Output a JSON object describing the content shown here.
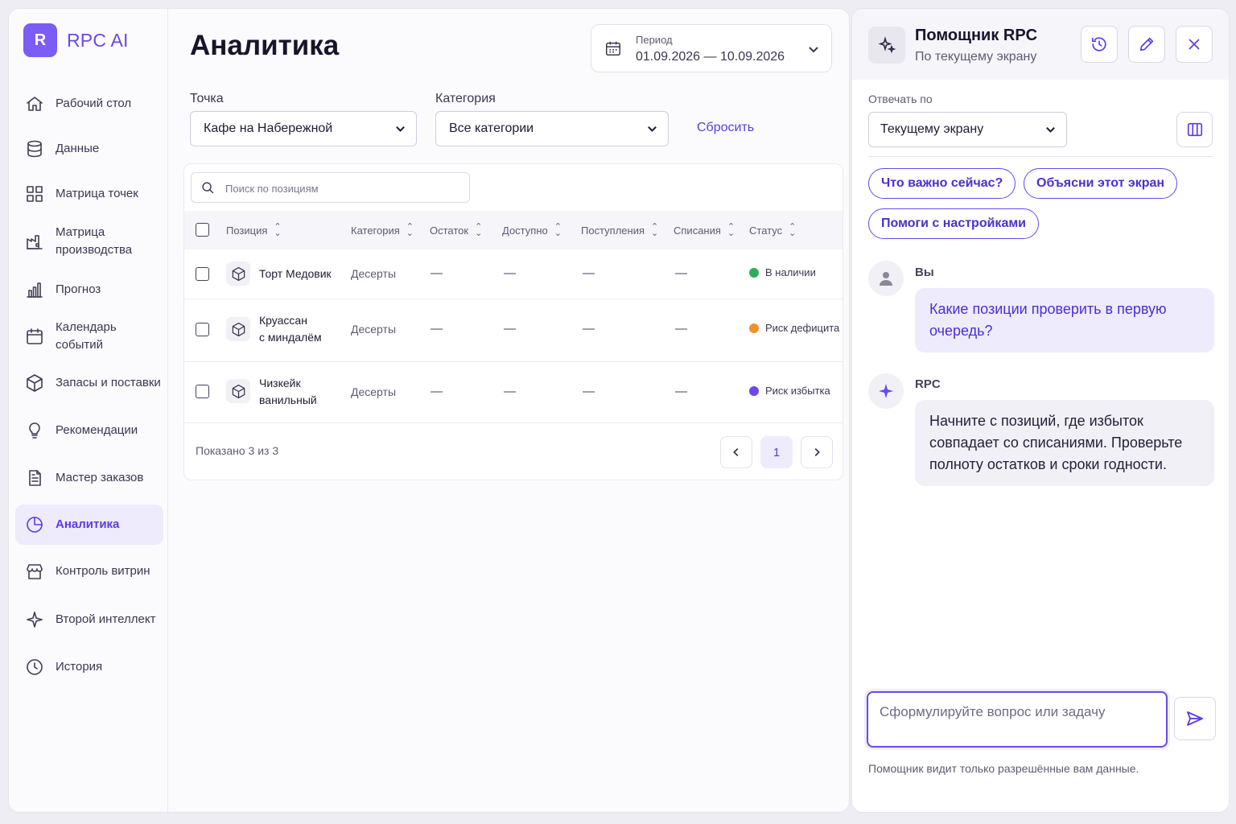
{
  "app": {
    "logo_letter": "R",
    "name": "RPC AI",
    "accent": "#6a48ee"
  },
  "sidebar": {
    "items": [
      {
        "label": "Рабочий стол",
        "icon": "home-icon"
      },
      {
        "label": "Данные",
        "icon": "database-icon"
      },
      {
        "label": "Матрица точек",
        "icon": "grid-icon"
      },
      {
        "label": "Матрица производства",
        "icon": "factory-icon"
      },
      {
        "label": "Прогноз",
        "icon": "bar-chart-icon"
      },
      {
        "label": "Календарь событий",
        "icon": "calendar-icon"
      },
      {
        "label": "Запасы и поставки",
        "icon": "box-icon"
      },
      {
        "label": "Рекомендации",
        "icon": "lightbulb-icon"
      },
      {
        "label": "Мастер заказов",
        "icon": "document-icon"
      },
      {
        "label": "Аналитика",
        "icon": "pie-chart-icon",
        "active": true
      },
      {
        "label": "Контроль витрин",
        "icon": "storefront-icon"
      },
      {
        "label": "Второй интеллект",
        "icon": "sparkle-icon"
      },
      {
        "label": "История",
        "icon": "clock-icon"
      }
    ]
  },
  "main": {
    "title": "Аналитика",
    "period": {
      "label": "Период",
      "value": "01.09.2026 — 10.09.2026"
    },
    "filters": {
      "point_label": "Точка",
      "point_value": "Кафе на Набережной",
      "category_label": "Категория",
      "category_value": "Все категории",
      "reset_label": "Сбросить"
    },
    "table": {
      "search_placeholder": "Поиск по позициям",
      "columns": [
        "Позиция",
        "Категория",
        "Остаток",
        "Доступно",
        "Поступления",
        "Списания",
        "Статус"
      ],
      "rows": [
        {
          "name_line1": "Торт Медовик",
          "name_line2": "",
          "category": "Десерты",
          "stock": "—",
          "available": "—",
          "incoming": "—",
          "writeoffs": "—",
          "status": "В наличии",
          "status_color": "#2fae5a"
        },
        {
          "name_line1": "Круассан",
          "name_line2": "с миндалём",
          "category": "Десерты",
          "stock": "—",
          "available": "—",
          "incoming": "—",
          "writeoffs": "—",
          "status": "Риск дефицита",
          "status_color": "#f2902c"
        },
        {
          "name_line1": "Чизкейк",
          "name_line2": "ванильный",
          "category": "Десерты",
          "stock": "—",
          "available": "—",
          "incoming": "—",
          "writeoffs": "—",
          "status": "Риск избытка",
          "status_color": "#6a48ee"
        }
      ],
      "footer_text": "Показано 3 из 3",
      "current_page": "1"
    }
  },
  "assistant": {
    "title": "Помощник RPC",
    "subtitle": "По текущему экрану",
    "answer_by_label": "Отвечать по",
    "answer_by_value": "Текущему экрану",
    "chips": [
      "Что важно сейчас?",
      "Объясни этот экран",
      "Помоги с настройками"
    ],
    "messages": [
      {
        "author": "Вы",
        "text": "Какие позиции проверить в первую очередь?"
      },
      {
        "author": "RPC",
        "text": "Начните с позиций, где избыток совпадает со списаниями. Проверьте полноту остатков и сроки годности."
      }
    ],
    "input_placeholder": "Сформулируйте вопрос или задачу",
    "note": "Помощник видит только разрешённые вам данные."
  }
}
